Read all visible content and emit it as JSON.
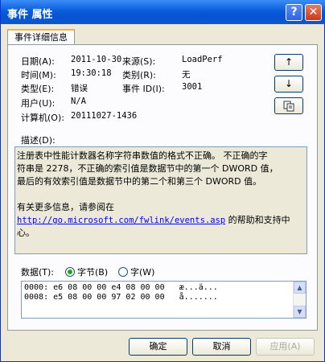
{
  "window": {
    "title": "事件 属性",
    "help": "?",
    "close": "✕"
  },
  "tab": "事件详细信息",
  "fields": {
    "date_label": "日期(A):",
    "date_value": "2011-10-30",
    "source_label": "来源(S):",
    "source_value": "LoadPerf",
    "time_label": "时间(M):",
    "time_value": "19:30:18",
    "category_label": "类别(R):",
    "category_value": "无",
    "type_label": "类型(E):",
    "type_value": "错误",
    "event_id_label": "事件 ID(I):",
    "event_id_value": "3001",
    "user_label": "用户(U):",
    "user_value": "N/A",
    "computer_label": "计算机(O):",
    "computer_value": "20111027-1436"
  },
  "nav": {
    "up": "↑",
    "down": "↓",
    "copy_icon": "copy-icon"
  },
  "description": {
    "label": "描述(D):",
    "line1": "注册表中性能计数器名称字符串数值的格式不正确。 不正确的字",
    "line2": "符串是 2278，不正确的索引值是数据节中的第一个 DWORD 值，",
    "line3": "最后的有效索引值是数据节中的第二个和第三个 DWORD 值。",
    "more": "有关更多信息，请参阅在",
    "link": "http://go.microsoft.com/fwlink/events.asp",
    "after_link": " 的帮助和支持中",
    "line_last": "心。"
  },
  "data_section": {
    "label": "数据(T):",
    "opt_bytes": "字节(B)",
    "opt_words": "字(W)",
    "selected": "bytes",
    "line1": "0000: e6 08 00 00 e4 08 00 00   æ...ä...",
    "line2": "0008: e5 08 00 00 97 02 00 00   å.......",
    "scroll_up": "▲",
    "scroll_down": "▼"
  },
  "buttons": {
    "ok": "确定",
    "cancel": "取消",
    "apply": "应用(A)"
  }
}
